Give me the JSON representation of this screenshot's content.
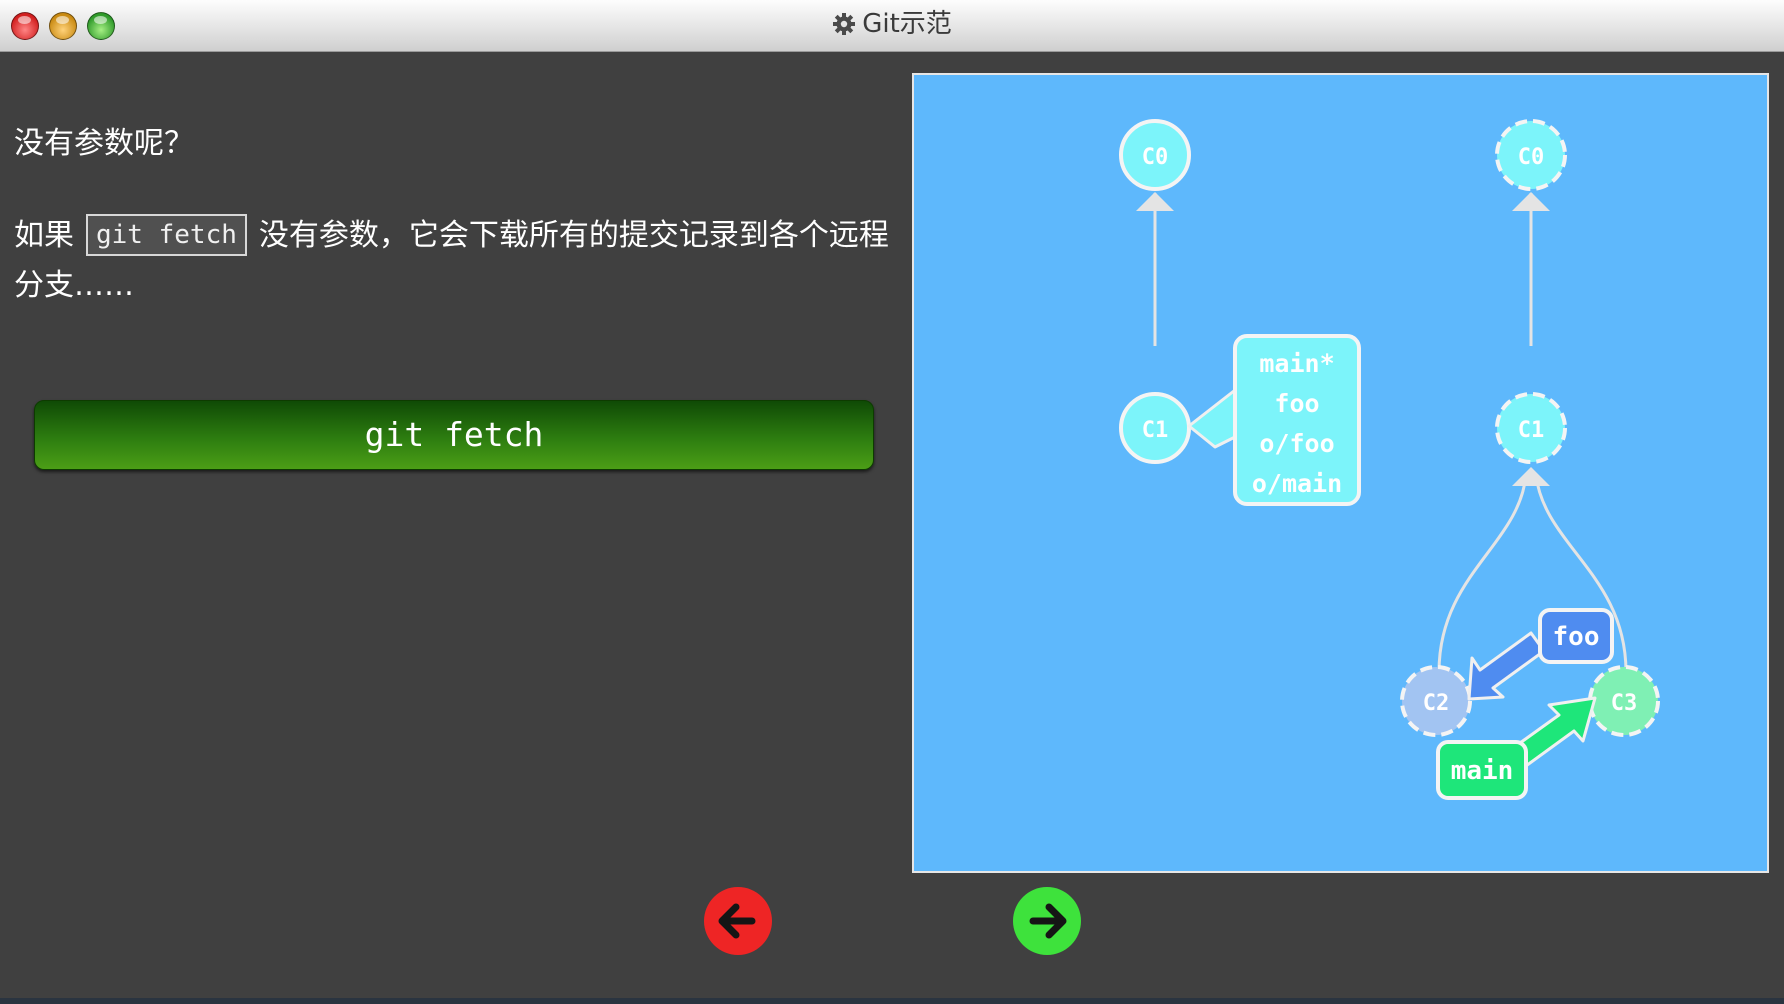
{
  "window": {
    "title": "Git示范",
    "title_icon": "gear-icon"
  },
  "content": {
    "heading": "没有参数呢？",
    "desc_prefix": "如果",
    "code": "git fetch",
    "desc_suffix": "没有参数，它会下载所有的提交记录到各个远程分支……",
    "command_button": "git fetch"
  },
  "graph": {
    "local": {
      "commits": [
        {
          "id": "C0",
          "label": "C0"
        },
        {
          "id": "C1",
          "label": "C1"
        }
      ],
      "branch_box": {
        "points_to": "C1",
        "lines": [
          "main*",
          "foo",
          "o/foo",
          "o/main"
        ]
      }
    },
    "remote": {
      "commits": [
        {
          "id": "C0",
          "label": "C0"
        },
        {
          "id": "C1",
          "label": "C1"
        },
        {
          "id": "C2",
          "label": "C2"
        },
        {
          "id": "C3",
          "label": "C3"
        }
      ],
      "branches": [
        {
          "name": "foo",
          "points_to": "C2",
          "color": "#4f8cf0"
        },
        {
          "name": "main",
          "points_to": "C3",
          "color": "#1ee67a"
        }
      ]
    }
  },
  "navigation": {
    "back_icon": "arrow-left-icon",
    "forward_icon": "arrow-right-icon"
  },
  "colors": {
    "panel_bg": "#5eb8fc",
    "command_button": "#2d7d10",
    "back_button": "#ee2525",
    "forward_button": "#3ee23c"
  }
}
